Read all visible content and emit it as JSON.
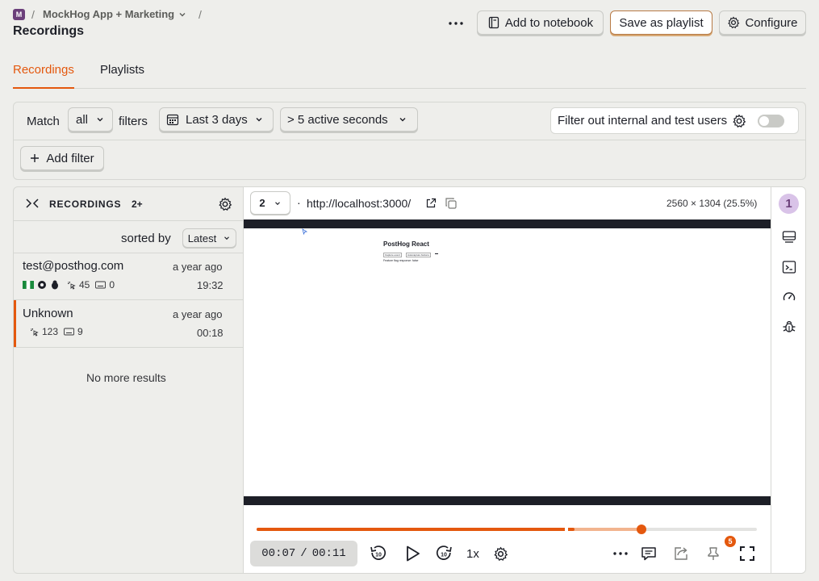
{
  "breadcrumb": {
    "org_initial": "M",
    "org_name": "MockHog App + Marketing",
    "sep": "/"
  },
  "page_title": "Recordings",
  "header_actions": {
    "more": "more",
    "add_to_notebook": "Add to notebook",
    "save_as_playlist": "Save as playlist",
    "configure": "Configure"
  },
  "tabs": [
    {
      "label": "Recordings",
      "active": true
    },
    {
      "label": "Playlists",
      "active": false
    }
  ],
  "filters": {
    "match_label": "Match",
    "match_value": "all",
    "filters_label": "filters",
    "date_range": "Last 3 days",
    "duration": "> 5 active seconds",
    "internal_users_label": "Filter out internal and test users",
    "internal_users_on": false,
    "add_filter": "Add filter"
  },
  "list": {
    "header_label": "RECORDINGS",
    "count": "2+",
    "sorted_by_label": "sorted by",
    "sort_value": "Latest",
    "items": [
      {
        "title": "test@posthog.com",
        "time_ago": "a year ago",
        "clicks": "45",
        "keypresses": "0",
        "duration": "19:32",
        "selected": false
      },
      {
        "title": "Unknown",
        "time_ago": "a year ago",
        "clicks": "123",
        "keypresses": "9",
        "duration": "00:18",
        "selected": true
      }
    ],
    "no_more": "No more results"
  },
  "player": {
    "window_number": "2",
    "dot": "·",
    "url": "http://localhost:3000/",
    "resolution": "2560 × 1304 (25.5%)",
    "preview": {
      "heading": "PostHog React",
      "btn1": "Capture event",
      "btn2": "Autocapture buttons",
      "text": "Feature flag response: false"
    },
    "progress_fraction": 0.636,
    "buffered_fraction": 0.77,
    "time_current": "00:07",
    "time_sep": "/",
    "time_total": "00:11",
    "speed": "1x",
    "notifications_count": "5"
  },
  "side_panel": {
    "badge": "1"
  },
  "colors": {
    "accent": "#e4580e",
    "background": "#eeeeeb"
  }
}
